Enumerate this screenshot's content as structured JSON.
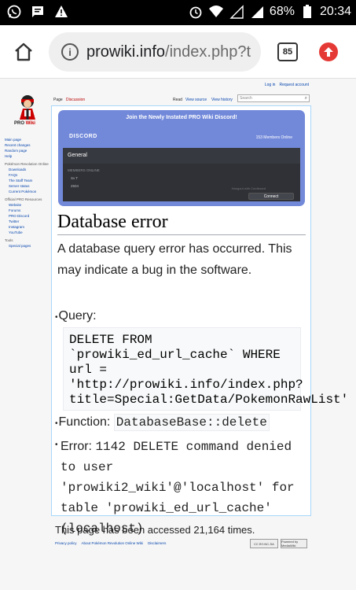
{
  "status_bar": {
    "battery": "68%",
    "time": "20:34",
    "icons": [
      "whatsapp-icon",
      "message-icon",
      "warning-icon",
      "alarm-icon",
      "wifi-icon",
      "signal-icon",
      "battery-icon"
    ]
  },
  "browser": {
    "url_host": "prowiki.info",
    "url_path": "/index.php?t",
    "tab_count": "85"
  },
  "wiki": {
    "logo_text_pro": "PRO",
    "logo_text_wiki": "Wiki",
    "personal_links": [
      "Log in",
      "Request account"
    ],
    "tabs": {
      "page": "Page",
      "discussion": "Discussion",
      "read": "Read",
      "view_source": "View source",
      "view_history": "View history"
    },
    "search_placeholder": "Search",
    "sidebar": {
      "main_page": "Main page",
      "recent_changes": "Recent changes",
      "random_page": "Random page",
      "help": "Help",
      "section_online": "Pokémon Revolution Online",
      "downloads": "Downloads",
      "faqs": "FAQs",
      "staff_team": "The Staff Team",
      "server_status": "Server status",
      "current_pokemon": "Current Pokémon",
      "section_resources": "Official PRO Resources",
      "website": "Website",
      "forums": "Forums",
      "pro_discord": "PRO Discord",
      "twitter": "Twitter",
      "instagram": "Instagram",
      "youtube": "YouTube",
      "section_tools": "Tools",
      "special_pages": "Special pages"
    },
    "discord": {
      "join": "Join the Newly Instated PRO Wiki Discord!",
      "logo": "DISCORD",
      "members": "153 Members Online",
      "channel": "General",
      "members_online_label": "MEMBERS ONLINE",
      "user1": "Sv T",
      "user2": "2504",
      "footer_note": "Hangout with Cordboard",
      "connect": "Connect"
    },
    "heading": "Database error",
    "message": "A database query error has occurred. This may indicate a bug in the software.",
    "query_label": "Query:",
    "query_code": "DELETE FROM\n`prowiki_ed_url_cache` WHERE\nurl =\n'http://prowiki.info/index.php?\ntitle=Special:GetData/PokemonRawList'",
    "function_label": "Function:",
    "function_value": "DatabaseBase::delete",
    "error_label": "Error:",
    "error_value": "1142 DELETE command denied to user 'prowiki2_wiki'@'localhost' for table 'prowiki_ed_url_cache' (localhost)",
    "accessed": "This page has been accessed 21,164 times.",
    "footer_links": [
      "Privacy policy",
      "About Pokémon Revolution Online Wiki",
      "Disclaimers"
    ],
    "cc_badge": "CC BY-NC-SA",
    "mw_badge": "Powered by MediaWiki"
  }
}
